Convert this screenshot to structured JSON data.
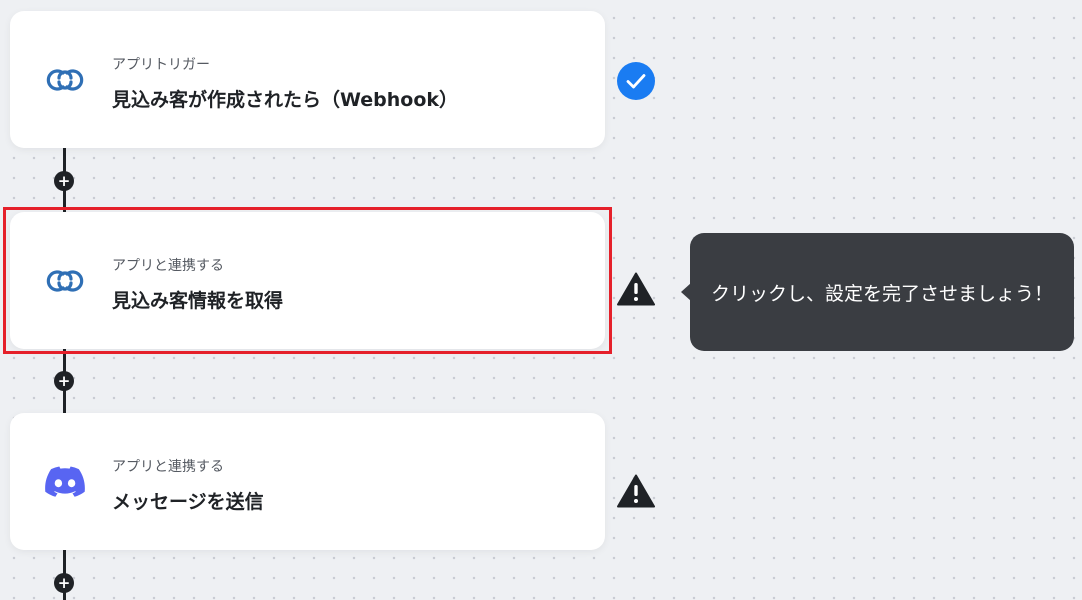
{
  "steps": [
    {
      "type_label": "アプリトリガー",
      "title": "見込み客が作成されたら（Webhook）",
      "icon": "zoho-link-icon",
      "status": "completed",
      "status_icon": "check-circle-icon"
    },
    {
      "type_label": "アプリと連携する",
      "title": "見込み客情報を取得",
      "icon": "zoho-link-icon",
      "status": "incomplete",
      "status_icon": "warning-icon",
      "highlighted": true
    },
    {
      "type_label": "アプリと連携する",
      "title": "メッセージを送信",
      "icon": "discord-icon",
      "status": "incomplete",
      "status_icon": "warning-icon"
    }
  ],
  "tooltip": {
    "text": "クリックし、設定を完了させましょう！"
  },
  "add_button_label": "+",
  "colors": {
    "accent_blue": "#1a7cf2",
    "link_icon": "#2f6fb5",
    "discord": "#5865f2",
    "highlight_border": "#e5202a",
    "tooltip_bg": "#3a3d42"
  }
}
